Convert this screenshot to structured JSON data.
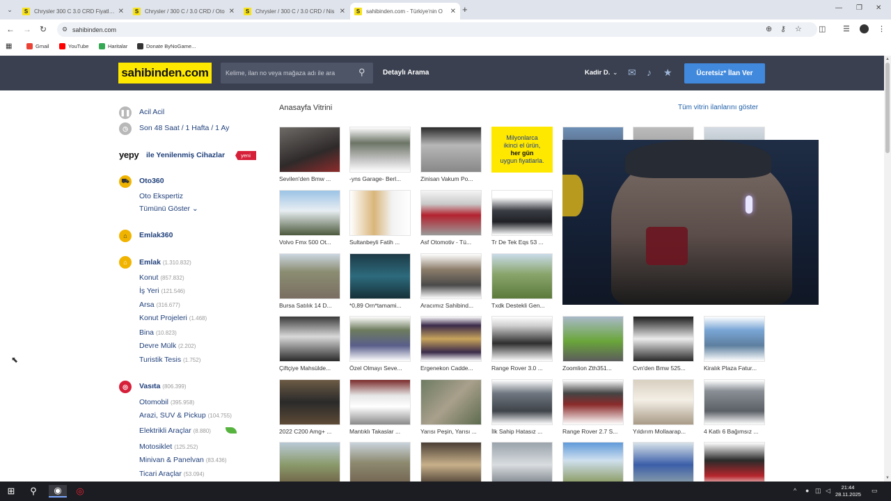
{
  "browser": {
    "tabs": [
      {
        "label": "Chrysler 300 C 3.0 CRD Fiyatları"
      },
      {
        "label": "Chrysler / 300 C / 3.0 CRD / Oto"
      },
      {
        "label": "Chrysler / 300 C / 3.0 CRD / Nis"
      },
      {
        "label": "sahibinden.com - Türkiye'nin O"
      }
    ],
    "url": "sahibinden.com",
    "bookmarks": [
      {
        "label": "Gmail",
        "color": "#ea4335"
      },
      {
        "label": "YouTube",
        "color": "#ff0000"
      },
      {
        "label": "Haritalar",
        "color": "#34a853"
      },
      {
        "label": "Donate ByNoGame...",
        "color": "#333333"
      }
    ]
  },
  "header": {
    "logo": "sahibinden.com",
    "search_placeholder": "Kelime, ilan no veya mağaza adı ile ara",
    "detailed_search": "Detaylı Arama",
    "user": "Kadir D.",
    "post_button": "Ücretsiz* İlan Ver"
  },
  "sidebar": {
    "urgent": "Acil Acil",
    "recent": "Son 48 Saat / 1 Hafta / 1 Ay",
    "yepy_logo": "yepy",
    "yepy_text": "ile Yenilenmiş Cihazlar",
    "yepy_badge": "yeni",
    "oto360": "Oto360",
    "oto_ekspertiz": "Oto Ekspertiz",
    "show_all": "Tümünü Göster",
    "emlak360": "Emlak360",
    "emlak": {
      "label": "Emlak",
      "count": "(1.310.832)",
      "items": [
        {
          "label": "Konut",
          "count": "(857.832)"
        },
        {
          "label": "İş Yeri",
          "count": "(121.546)"
        },
        {
          "label": "Arsa",
          "count": "(316.677)"
        },
        {
          "label": "Konut Projeleri",
          "count": "(1.468)"
        },
        {
          "label": "Bina",
          "count": "(10.823)"
        },
        {
          "label": "Devre Mülk",
          "count": "(2.202)"
        },
        {
          "label": "Turistik Tesis",
          "count": "(1.752)"
        }
      ]
    },
    "vasita": {
      "label": "Vasıta",
      "count": "(806.399)",
      "items": [
        {
          "label": "Otomobil",
          "count": "(395.958)"
        },
        {
          "label": "Arazi, SUV & Pickup",
          "count": "(104.755)"
        },
        {
          "label": "Elektrikli Araçlar",
          "count": "(8.880)"
        },
        {
          "label": "Motosiklet",
          "count": "(125.252)"
        },
        {
          "label": "Minivan & Panelvan",
          "count": "(83.436)"
        },
        {
          "label": "Ticari Araçlar",
          "count": "(53.094)"
        }
      ]
    }
  },
  "showcase": {
    "title": "Anasayfa Vitrini",
    "all_link": "Tüm vitrin ilanlarını göster",
    "ad_banner": {
      "line1": "Milyonlarca",
      "line2": "ikinci el ürün,",
      "line3": "her gün",
      "line4": "uygun fiyatlarla."
    },
    "captions": [
      "Sevilen'den Bmw ...",
      "-yns Garage- Berl...",
      "Zinisan Vakum Po...",
      "Volvo Fmx 500 Ot...",
      "Sultanbeyli Fatih ...",
      "Asf Otomotiv - Tü...",
      "Tr De Tek Eqs 53 ...",
      "Bursa Satılık 14 D...",
      "*0,89 Orn*tamami...",
      "Aracımız Sahibind...",
      "Txdk Destekli Gen...",
      "Çiftçiye Mahsülde...",
      "Özel Olmayı Seve...",
      "Ergenekon Cadde...",
      "Range Rover 3.0 ...",
      "Zoomlion Zth351...",
      "Cvn'den Bmw 525...",
      "Kiralık Plaza Fatur...",
      "2022 C200 Amg+ ...",
      "Mantıklı Takaslar ...",
      "Yarısı Peşin, Yarısı ...",
      "İlk Sahip Hatasız ...",
      "Range Rover 2.7 S...",
      "Yıldırım Mollaarap...",
      "4 Katlı 6 Bağımsız ..."
    ]
  },
  "taskbar": {
    "time": "21:44",
    "date": "28.11.2025"
  }
}
